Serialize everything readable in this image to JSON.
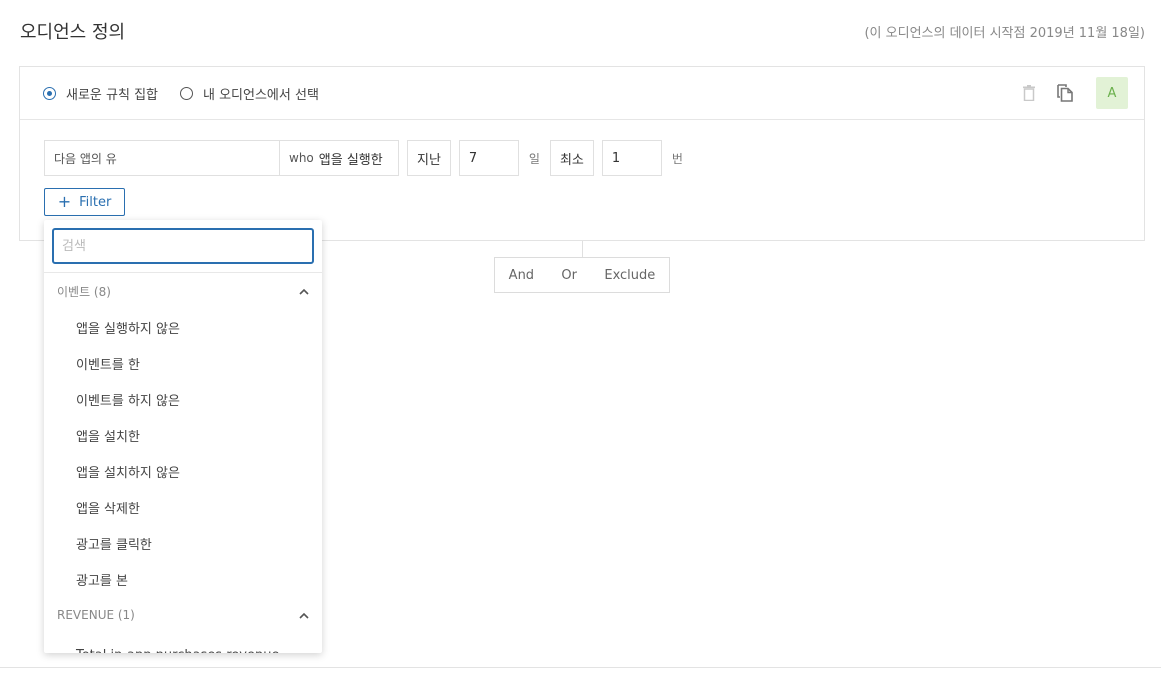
{
  "page": {
    "title": "오디언스 정의",
    "data_start": "(이 오디언스의 데이터 시작점 2019년 11월 18일)"
  },
  "rule_card": {
    "radio_new": "새로운 규칙 집합",
    "radio_existing": "내 오디언스에서 선택",
    "selected_radio": "새로운 규칙 집합",
    "badge": "A",
    "icons": [
      "trash-icon",
      "copy-icon"
    ]
  },
  "condition": {
    "first_select": "다음 앱의 유",
    "who_prefix": "who",
    "action": "앱을 실행한",
    "period_label": "지난",
    "period_value": "7",
    "period_unit": "일",
    "min_label": "최소",
    "min_value": "1",
    "min_unit": "번"
  },
  "filter_button": {
    "icon": "plus-icon",
    "label": "Filter"
  },
  "logic": {
    "and": "And",
    "or": "Or",
    "exclude": "Exclude"
  },
  "dropdown": {
    "search_placeholder": "검색",
    "search_value": "",
    "groups": [
      {
        "label": "이벤트 (8)",
        "expanded": true,
        "items": [
          "앱을 실행하지 않은",
          "이벤트를 한",
          "이벤트를 하지 않은",
          "앱을 설치한",
          "앱을 설치하지 않은",
          "앱을 삭제한",
          "광고를 클릭한",
          "광고를 본"
        ]
      },
      {
        "label": "REVENUE (1)",
        "expanded": true,
        "items": [
          "Total in-app purchases revenue"
        ]
      }
    ]
  },
  "colors": {
    "accent": "#2a6fb0",
    "badge_bg": "#e2f2d6",
    "badge_text": "#6ab04c"
  }
}
